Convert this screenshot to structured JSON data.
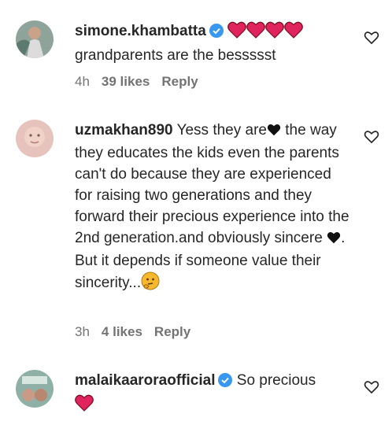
{
  "comments": [
    {
      "username": "simone.khambatta",
      "verified": true,
      "text": "grandparents are the bessssst",
      "time": "4h",
      "likes": "39 likes",
      "reply": "Reply"
    },
    {
      "username": "uzmakhan890",
      "verified": false,
      "text_lines": [
        "Yess they are",
        "the way they educates the kids even the parents can't do because they are experienced for raising two generations and they forward their precious experience into the 2nd generation.and obviously sincere",
        ". But it depends if someone value their sincerity..."
      ],
      "time": "3h",
      "likes": "4 likes",
      "reply": "Reply"
    },
    {
      "username": "malaikaaroraofficial",
      "verified": true,
      "text": "So precious",
      "time": "",
      "likes": "",
      "reply": ""
    }
  ],
  "colors": {
    "heart_red": "#e0245e",
    "verified_blue": "#3897f0",
    "meta_gray": "#737373"
  }
}
